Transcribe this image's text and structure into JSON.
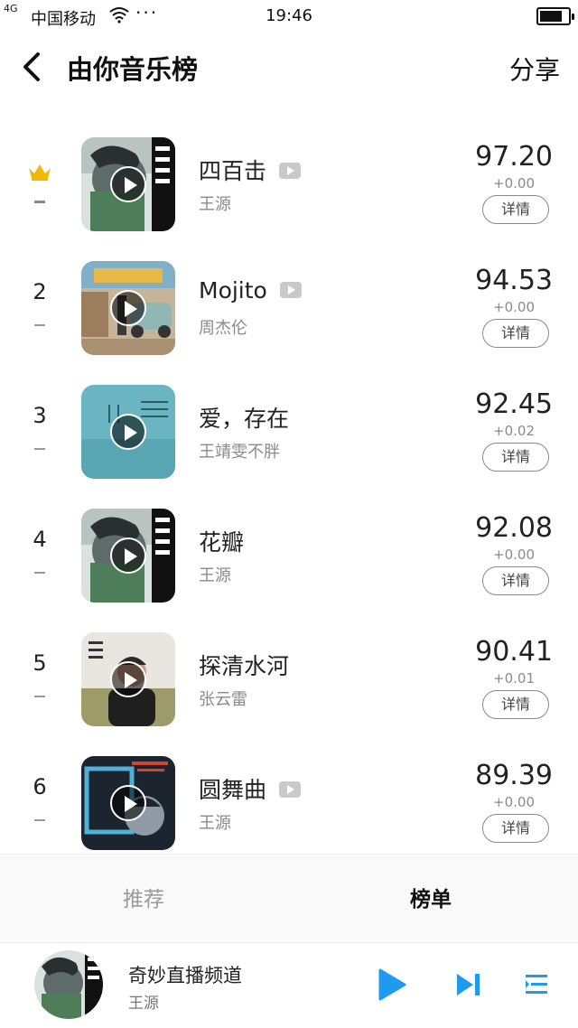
{
  "status": {
    "network": "4G",
    "carrier": "中国移动",
    "time": "19:46"
  },
  "header": {
    "title": "由你音乐榜",
    "share_label": "分享"
  },
  "songs": [
    {
      "rank": "",
      "title": "四百击",
      "has_mv": true,
      "artist": "王源",
      "score": "97.20",
      "delta": "+0.00",
      "detail_label": "详情"
    },
    {
      "rank": "2",
      "title": "Mojito",
      "has_mv": true,
      "artist": "周杰伦",
      "score": "94.53",
      "delta": "+0.00",
      "detail_label": "详情"
    },
    {
      "rank": "3",
      "title": "爱，存在",
      "has_mv": false,
      "artist": "王靖雯不胖",
      "score": "92.45",
      "delta": "+0.02",
      "detail_label": "详情"
    },
    {
      "rank": "4",
      "title": "花瓣",
      "has_mv": false,
      "artist": "王源",
      "score": "92.08",
      "delta": "+0.00",
      "detail_label": "详情"
    },
    {
      "rank": "5",
      "title": "探清水河",
      "has_mv": false,
      "artist": "张云雷",
      "score": "90.41",
      "delta": "+0.01",
      "detail_label": "详情"
    },
    {
      "rank": "6",
      "title": "圆舞曲",
      "has_mv": true,
      "artist": "王源",
      "score": "89.39",
      "delta": "+0.00",
      "detail_label": "详情"
    }
  ],
  "tabs": {
    "recommend_label": "推荐",
    "chart_label": "榜单",
    "active": "榜单"
  },
  "player": {
    "title": "奇妙直播频道",
    "artist": "王源"
  },
  "colors": {
    "accent": "#1e9bf0",
    "crown": "#f2b705",
    "text": "#222222",
    "muted": "#8a8a8a"
  }
}
